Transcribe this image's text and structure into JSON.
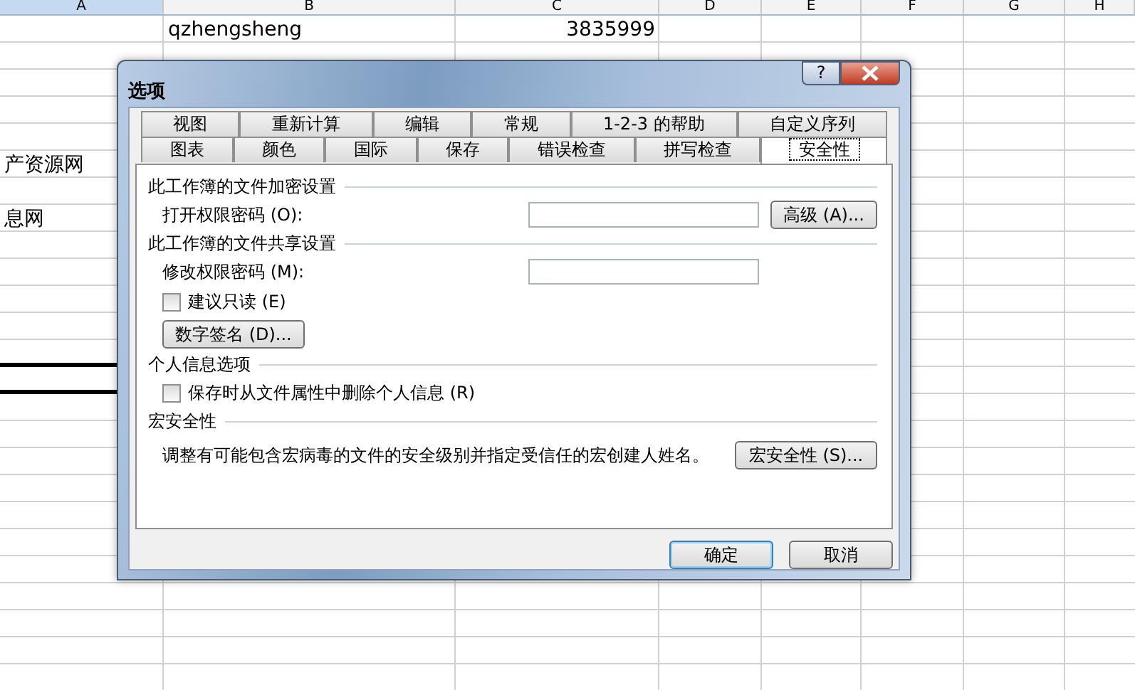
{
  "sheet": {
    "columns": [
      {
        "label": "A",
        "selected": true
      },
      {
        "label": "B",
        "selected": false
      },
      {
        "label": "C",
        "selected": false
      },
      {
        "label": "D",
        "selected": false
      },
      {
        "label": "E",
        "selected": false
      },
      {
        "label": "F",
        "selected": false
      },
      {
        "label": "G",
        "selected": false
      },
      {
        "label": "H",
        "selected": false
      }
    ],
    "rows": [
      {
        "B": {
          "text": "qzhengsheng"
        },
        "C": {
          "text": "3835999",
          "kind": "number"
        }
      },
      {},
      {},
      {},
      {},
      {
        "A": {
          "text": "产资源网"
        }
      },
      {},
      {
        "A": {
          "text": "息网"
        }
      },
      {},
      {},
      {},
      {},
      {
        "A": {
          "thick_bottom_border": true
        }
      },
      {
        "A": {
          "thick_bottom_border": true
        }
      }
    ]
  },
  "dialog": {
    "title": "选项",
    "title_buttons": [
      {
        "kind": "help",
        "label": "?"
      },
      {
        "kind": "close"
      }
    ],
    "tab_rows": [
      [
        {
          "label": "视图",
          "selected": false
        },
        {
          "label": "重新计算",
          "selected": false
        },
        {
          "label": "编辑",
          "selected": false
        },
        {
          "label": "常规",
          "selected": false
        },
        {
          "label": "1-2-3 的帮助",
          "selected": false
        },
        {
          "label": "自定义序列",
          "selected": false
        }
      ],
      [
        {
          "label": "图表",
          "selected": false
        },
        {
          "label": "颜色",
          "selected": false
        },
        {
          "label": "国际",
          "selected": false
        },
        {
          "label": "保存",
          "selected": false
        },
        {
          "label": "错误检查",
          "selected": false
        },
        {
          "label": "拼写检查",
          "selected": false
        },
        {
          "label": "安全性",
          "selected": true
        }
      ]
    ],
    "sections": [
      {
        "heading": "此工作簿的文件加密设置",
        "items": [
          {
            "kind": "password",
            "label": "打开权限密码 (O):",
            "button": "高级 (A)..."
          }
        ]
      },
      {
        "heading": "此工作簿的文件共享设置",
        "items": [
          {
            "kind": "password",
            "label": "修改权限密码 (M):"
          },
          {
            "kind": "checkbox",
            "label": "建议只读 (E)",
            "checked": false
          },
          {
            "kind": "button",
            "label": "数字签名 (D)..."
          }
        ]
      },
      {
        "heading": "个人信息选项",
        "items": [
          {
            "kind": "checkbox",
            "label": "保存时从文件属性中删除个人信息 (R)",
            "checked": false
          }
        ]
      },
      {
        "heading": "宏安全性",
        "items": [
          {
            "kind": "text",
            "text": "调整有可能包含宏病毒的文件的安全级别并指定受信任的宏创建人姓名。",
            "button": "宏安全性 (S)..."
          }
        ]
      }
    ],
    "footer_buttons": [
      {
        "label": "确定",
        "default": true
      },
      {
        "label": "取消",
        "default": false
      }
    ]
  }
}
